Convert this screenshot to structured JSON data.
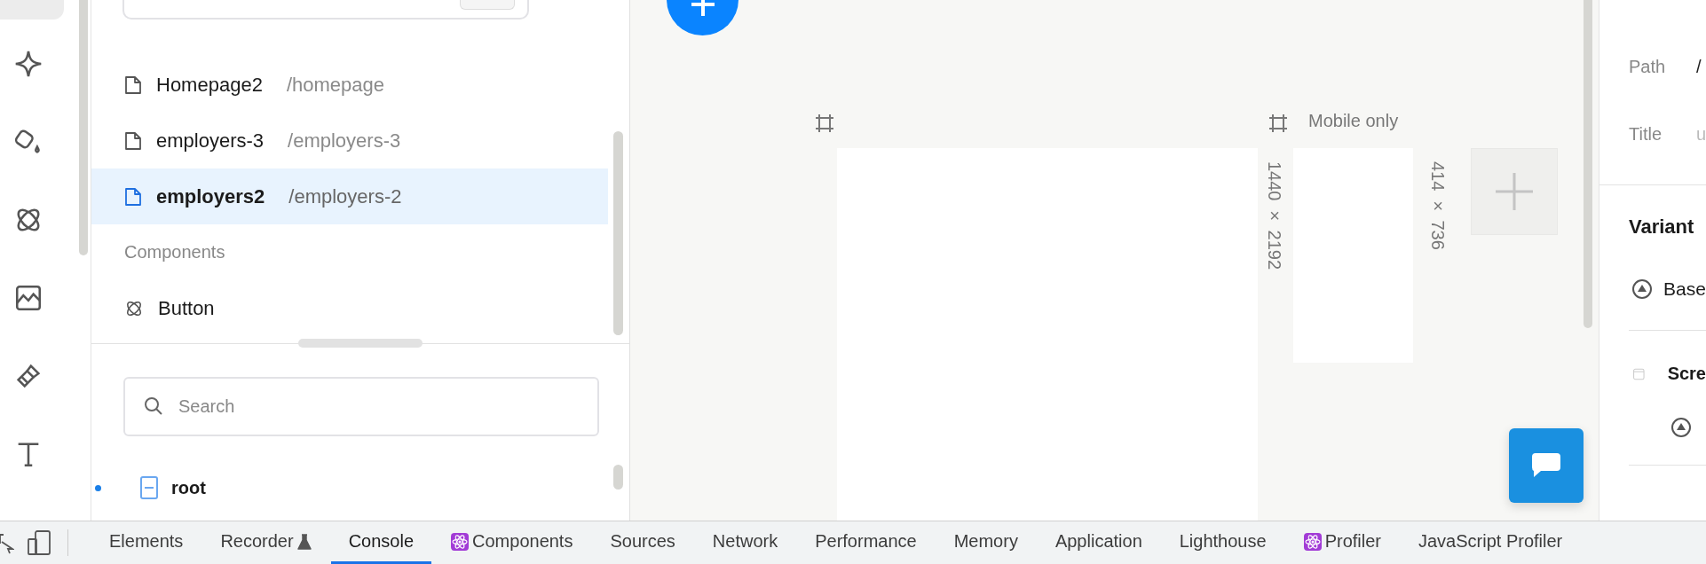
{
  "pages_panel": {
    "pages": [
      {
        "name": "Homepage2",
        "path": "/homepage",
        "selected": false
      },
      {
        "name": "employers-3",
        "path": "/employers-3",
        "selected": false
      },
      {
        "name": "employers2",
        "path": "/employers-2",
        "selected": true
      }
    ],
    "components_heading": "Components",
    "components": [
      {
        "name": "Button"
      }
    ]
  },
  "layers": {
    "search": {
      "placeholder": "Search"
    },
    "tree": [
      {
        "label": "root",
        "selected": true
      }
    ]
  },
  "canvas": {
    "frames": [
      {
        "kind": "desktop",
        "size": "1440 × 2192"
      },
      {
        "kind": "mobile",
        "label": "Mobile only",
        "size": "414 × 736"
      }
    ]
  },
  "inspector": {
    "fields": [
      {
        "label": "Path",
        "value": "/"
      },
      {
        "label": "Title",
        "placeholder": "u"
      }
    ],
    "variants_heading": "Variant",
    "variants": [
      {
        "label": "Base"
      }
    ],
    "group": {
      "label": "Scre"
    }
  },
  "devtools": {
    "tabs": [
      {
        "label": "Elements",
        "kind": "plain",
        "selected": false
      },
      {
        "label": "Recorder",
        "kind": "beaker",
        "selected": false
      },
      {
        "label": "Console",
        "kind": "plain",
        "selected": true
      },
      {
        "label": "Components",
        "kind": "react",
        "selected": false
      },
      {
        "label": "Sources",
        "kind": "plain",
        "selected": false
      },
      {
        "label": "Network",
        "kind": "plain",
        "selected": false
      },
      {
        "label": "Performance",
        "kind": "plain",
        "selected": false
      },
      {
        "label": "Memory",
        "kind": "plain",
        "selected": false
      },
      {
        "label": "Application",
        "kind": "plain",
        "selected": false
      },
      {
        "label": "Lighthouse",
        "kind": "plain",
        "selected": false
      },
      {
        "label": "Profiler",
        "kind": "react",
        "selected": false
      },
      {
        "label": "JavaScript Profiler",
        "kind": "plain",
        "selected": false
      }
    ]
  }
}
